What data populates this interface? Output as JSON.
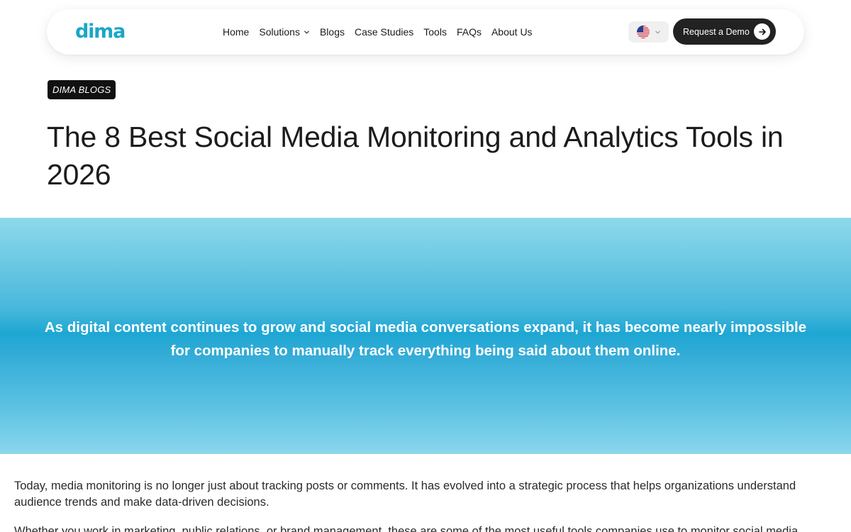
{
  "nav": {
    "logo": "dima",
    "links": [
      {
        "label": "Home"
      },
      {
        "label": "Solutions",
        "has_dropdown": true
      },
      {
        "label": "Blogs"
      },
      {
        "label": "Case Studies"
      },
      {
        "label": "Tools"
      },
      {
        "label": "FAQs"
      },
      {
        "label": "About Us"
      }
    ],
    "language_flag": "us-flag-icon",
    "cta_label": "Request a Demo"
  },
  "article": {
    "badge": "DIMA BLOGS",
    "title": "The 8 Best Social Media Monitoring and Analytics Tools in 2026",
    "hero_text": "As digital content continues to grow and social media conversations expand, it has become nearly impossible for companies to manually track everything being said about them online.",
    "paragraphs": [
      "Today, media monitoring is no longer just about tracking posts or comments. It has evolved into a strategic process that helps organizations understand audience trends and make data-driven decisions.",
      "Whether you work in marketing, public relations, or brand management, these are some of the most useful tools companies use to monitor social media"
    ]
  },
  "colors": {
    "brand": "#1aa6c9",
    "cta_background": "#222222",
    "hero_gradient_mid": "#1ea7d3"
  }
}
